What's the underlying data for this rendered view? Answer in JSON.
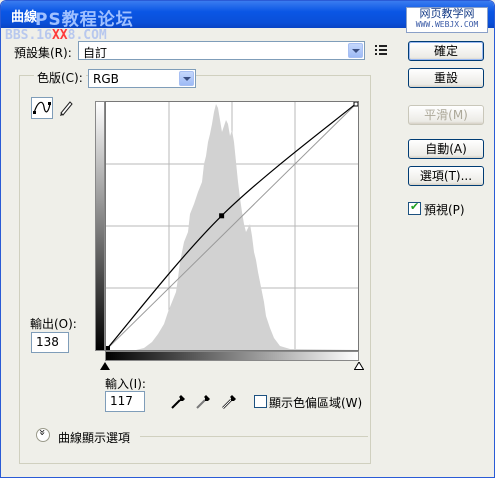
{
  "window": {
    "title": "曲線",
    "watermark_top": "PS教程论坛",
    "watermark_url_pre": "BBS.16",
    "watermark_url_xx": "XX",
    "watermark_url_post": "8.COM",
    "watermark_right_line1": "网页教学网",
    "watermark_right_line2": "WWW.WEBJX.COM"
  },
  "preset": {
    "label": "預設集(R):",
    "value": "自訂"
  },
  "channel": {
    "label": "色版(C):",
    "value": "RGB"
  },
  "buttons": {
    "ok": "確定",
    "reset": "重設",
    "smooth": "平滑(M)",
    "auto": "自動(A)",
    "options": "選項(T)..."
  },
  "preview": {
    "label": "預視(P)",
    "checked": true
  },
  "output": {
    "label": "輸出(O):",
    "value": "138"
  },
  "input": {
    "label": "輸入(I):",
    "value": "117"
  },
  "clipping": {
    "label": "顯示色偏區域(W)",
    "checked": false
  },
  "display_options": {
    "label": "曲線顯示選項"
  },
  "curve": {
    "points": [
      [
        0,
        0
      ],
      [
        117,
        138
      ],
      [
        255,
        255
      ]
    ]
  },
  "icons": {
    "curve_tool": "curve-point-icon",
    "pencil_tool": "pencil-icon",
    "preset_menu": "preset-options-icon",
    "eyedropper_black": "black-eyedropper-icon",
    "eyedropper_gray": "gray-eyedropper-icon",
    "eyedropper_white": "white-eyedropper-icon"
  }
}
